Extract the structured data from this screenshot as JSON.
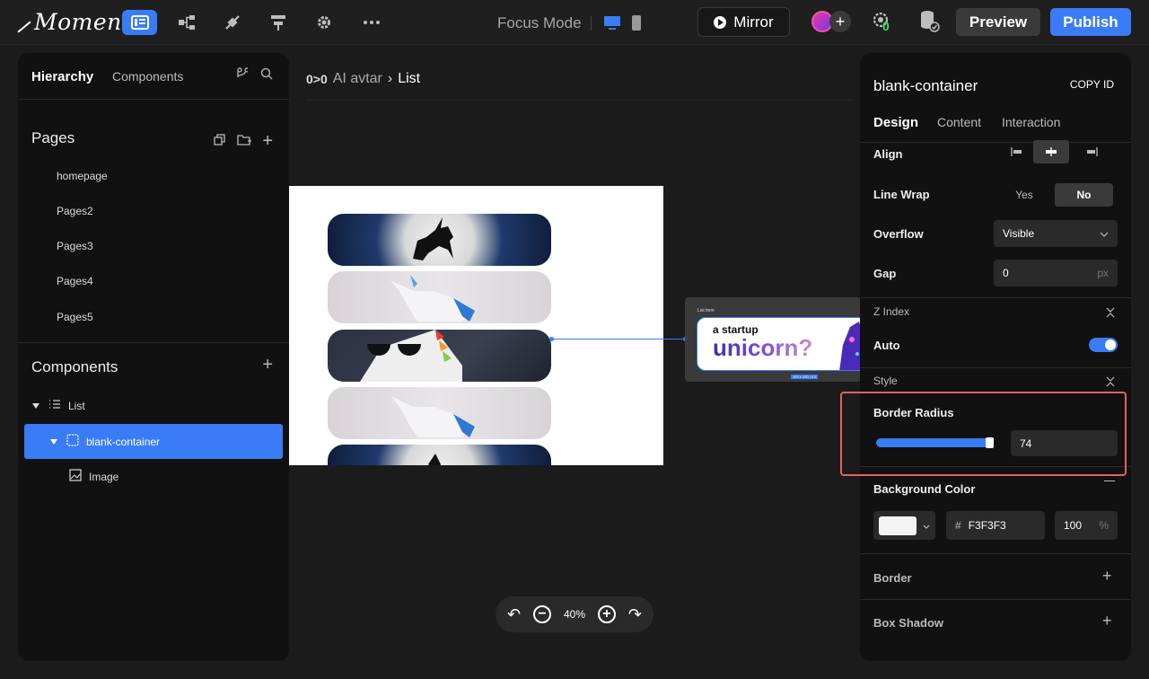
{
  "topbar": {
    "logo": "Momen",
    "focus_mode": "Focus Mode",
    "mirror_label": "Mirror",
    "badge_count": "0",
    "preview_label": "Preview",
    "publish_label": "Publish"
  },
  "left_panel": {
    "tabs": {
      "hierarchy": "Hierarchy",
      "components": "Components"
    },
    "pages_title": "Pages",
    "pages": [
      "homepage",
      "Pages2",
      "Pages3",
      "Pages4",
      "Pages5"
    ],
    "components_title": "Components",
    "tree": {
      "list": "List",
      "blank_container": "blank-container",
      "image": "Image"
    }
  },
  "canvas": {
    "breadcrumb": {
      "root": "AI avtar",
      "current": "List"
    },
    "zoom": "40%",
    "preview_card": {
      "tag": "List item",
      "line1": "a startup",
      "line2": "unicorn?",
      "size": "100 x 100 | 0.0"
    }
  },
  "right_panel": {
    "title": "blank-container",
    "copy_id": "COPY ID",
    "tabs": {
      "design": "Design",
      "content": "Content",
      "interaction": "Interaction"
    },
    "align_label": "Align",
    "line_wrap": {
      "label": "Line Wrap",
      "yes": "Yes",
      "no": "No"
    },
    "overflow": {
      "label": "Overflow",
      "value": "Visible"
    },
    "gap": {
      "label": "Gap",
      "value": "0",
      "unit": "px"
    },
    "z_index": {
      "label": "Z Index",
      "auto": "Auto"
    },
    "style_label": "Style",
    "border_radius": {
      "label": "Border Radius",
      "value": "74"
    },
    "background_color": {
      "label": "Background Color",
      "hash": "#",
      "hex": "F3F3F3",
      "opacity": "100",
      "unit": "%"
    },
    "border_label": "Border",
    "box_shadow_label": "Box Shadow"
  },
  "colors": {
    "accent": "#3a7cf5",
    "highlight": "#e2625a",
    "panel": "#111111",
    "canvas": "#1b1b1b"
  }
}
